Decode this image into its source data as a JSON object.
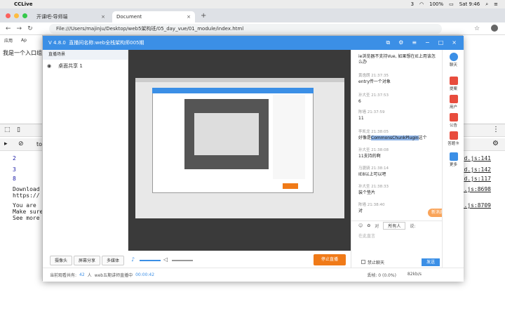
{
  "menubar": {
    "app": "CCLive",
    "time": "Sat 9:46",
    "battery": "100%",
    "badge": "3"
  },
  "tabs": [
    {
      "label": "开课吧-导师端"
    },
    {
      "label": "Document"
    }
  ],
  "address": {
    "url": "File:///Users/majinju/Desktop/web5架构班/05_day_vue/01_module/index.html"
  },
  "bookmarks": {
    "apps": "应用",
    "item": "Ap"
  },
  "page": {
    "text": "我是一个入口组"
  },
  "console": {
    "filter": "to",
    "lines": [
      "2",
      "3",
      "8"
    ],
    "links": [
      "d.js:141",
      "d.js:142",
      "d.js:117",
      "s.js:8698",
      "s.js:8709"
    ],
    "download": "Download",
    "https": "https://",
    "youare": "You are",
    "makesure": "Make sure",
    "seemore": "See more"
  },
  "live": {
    "version": "V 4.8.0",
    "title_prefix": "直播间名称:",
    "room_name": "web全栈架构师005期",
    "live_list": "直播场景",
    "source": "桌面共享 1",
    "buttons": {
      "camera": "摄像头",
      "screen": "屏幕分享",
      "media": "多媒体",
      "stop": "停止直播"
    },
    "status": {
      "online_label": "当前观看共有:",
      "online_count": "42",
      "online_unit": "人",
      "room": "web五期讲师直播中",
      "elapsed": "00:00:42",
      "loss": "丢帧: 0 (0.0%)",
      "rate": "82kb/s"
    }
  },
  "chat": {
    "messages": [
      {
        "who": "",
        "text": "ie浏览器不支持Vue, 如果想在IE上用该怎么办"
      },
      {
        "who": "黄逸朗 21:37:35",
        "text": "entry传一个对象"
      },
      {
        "who": "孙大圣 21:37:53",
        "text": "6"
      },
      {
        "who": "陈墙 21:37:59",
        "text": "11"
      },
      {
        "who": "李凯龙 21:38:05",
        "text_pre": "好像是",
        "text_hl": "CommonsChunkPlugin",
        "text_post": "这个"
      },
      {
        "who": "孙大圣 21:38:08",
        "text": "11支持的啊"
      },
      {
        "who": "马骁骑 21:38:14",
        "text": "IE8以上可以吧"
      },
      {
        "who": "孙大圣 21:38:33",
        "text": "装个垫片"
      },
      {
        "who": "陈墙 21:38:40",
        "text": "对"
      }
    ],
    "new_msg": "新消息",
    "to_label": "对",
    "to_value": "所有人",
    "say": "说:",
    "placeholder": "在此直言",
    "ban": "禁止聊天",
    "send": "发送"
  },
  "rightbar": [
    {
      "label": "聊天",
      "color": "#3b8fe6"
    },
    {
      "label": "提案",
      "color": "#e84c3d"
    },
    {
      "label": "用户",
      "color": "#e84c3d"
    },
    {
      "label": "公告",
      "color": "#e84c3d"
    },
    {
      "label": "答题卡",
      "color": "#e84c3d"
    },
    {
      "label": "更多",
      "color": "#3b8fe6"
    }
  ]
}
